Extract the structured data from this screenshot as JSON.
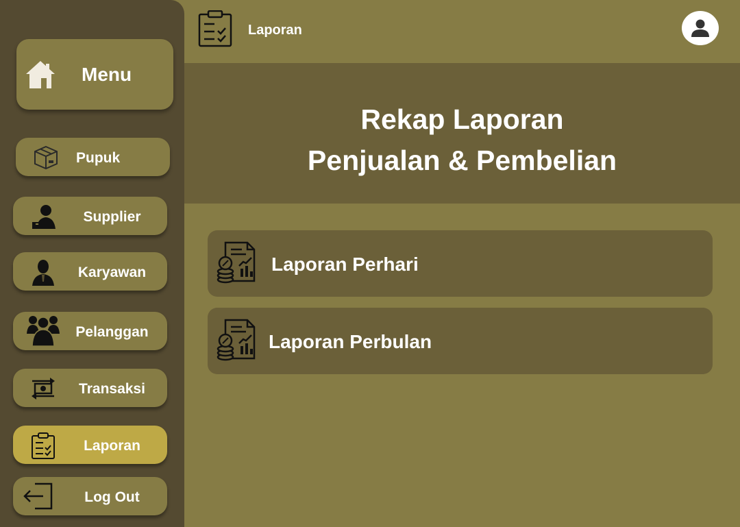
{
  "sidebar": {
    "menu_label": "Menu",
    "items": [
      {
        "label": "Pupuk",
        "icon": "box-icon"
      },
      {
        "label": "Supplier",
        "icon": "supplier-icon"
      },
      {
        "label": "Karyawan",
        "icon": "employee-icon"
      },
      {
        "label": "Pelanggan",
        "icon": "customers-icon"
      },
      {
        "label": "Transaksi",
        "icon": "transaction-icon"
      },
      {
        "label": "Laporan",
        "icon": "clipboard-icon",
        "active": true
      },
      {
        "label": "Log Out",
        "icon": "logout-icon"
      }
    ]
  },
  "header": {
    "title": "Laporan"
  },
  "banner": {
    "line1": "Rekap Laporan",
    "line2": "Penjualan & Pembelian"
  },
  "reports": [
    {
      "label": "Laporan Perhari"
    },
    {
      "label": "Laporan Perbulan"
    }
  ],
  "colors": {
    "sidebar_bg": "#544a31",
    "main_bg": "#867c45",
    "panel_bg": "#6b6039",
    "active_item": "#bea946"
  }
}
